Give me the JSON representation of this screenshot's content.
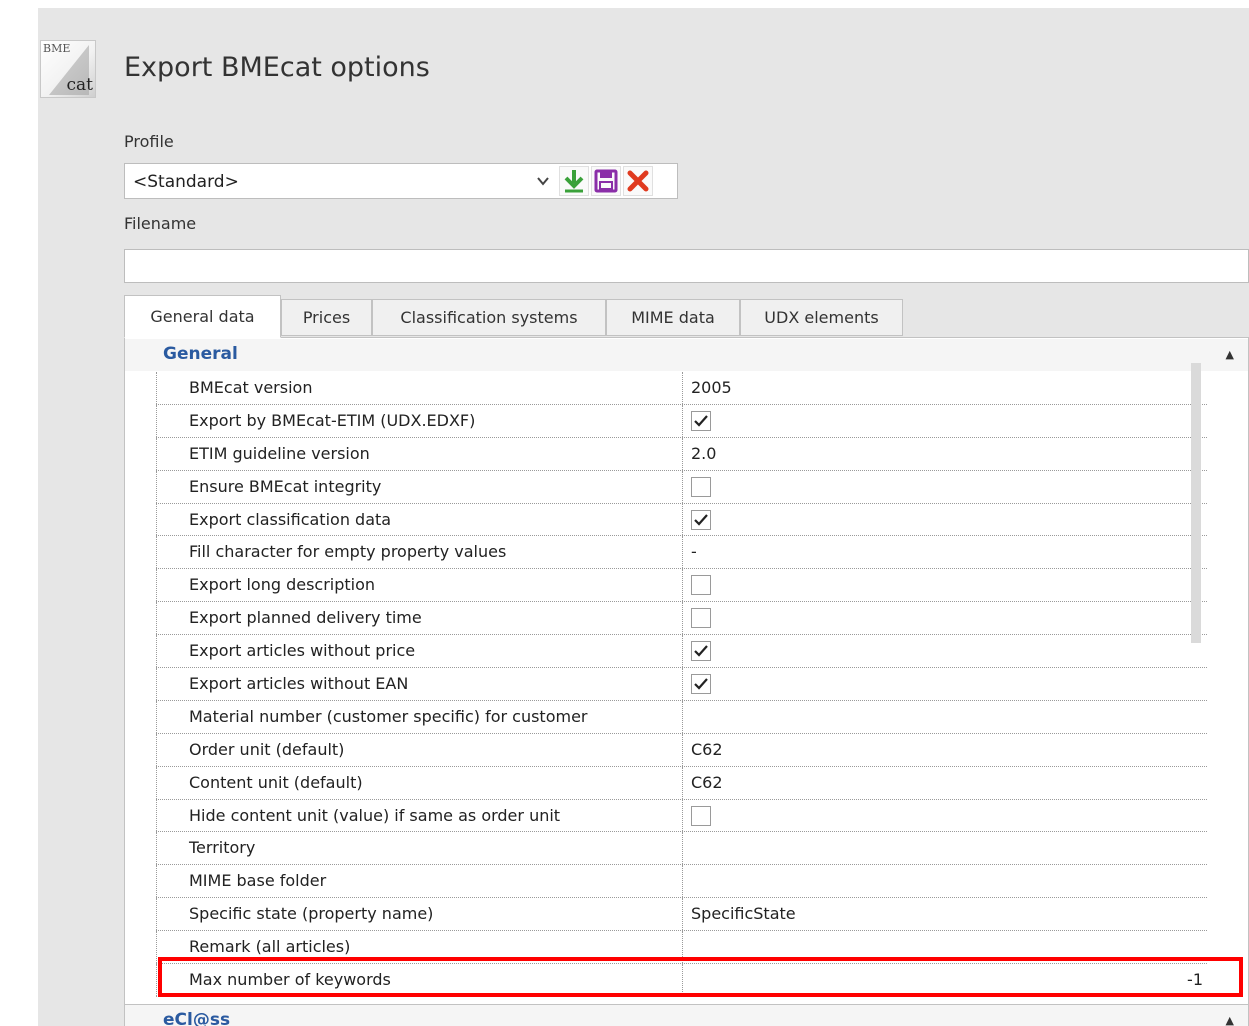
{
  "app": {
    "icon_line1": "BME",
    "icon_line2": "cat",
    "title": "Export BMEcat options"
  },
  "profile": {
    "label": "Profile",
    "value": "<Standard>"
  },
  "filename": {
    "label": "Filename",
    "value": ""
  },
  "tabs": [
    {
      "label": "General data",
      "active": true
    },
    {
      "label": "Prices",
      "active": false
    },
    {
      "label": "Classification systems",
      "active": false
    },
    {
      "label": "MIME data",
      "active": false
    },
    {
      "label": "UDX elements",
      "active": false
    }
  ],
  "categories": {
    "general": "General",
    "eclass": "eCl@ss"
  },
  "properties": [
    {
      "name": "BMEcat version",
      "type": "text",
      "value": "2005"
    },
    {
      "name": "Export by BMEcat-ETIM (UDX.EDXF)",
      "type": "checkbox",
      "checked": true
    },
    {
      "name": "ETIM guideline version",
      "type": "text",
      "value": "2.0"
    },
    {
      "name": "Ensure BMEcat integrity",
      "type": "checkbox",
      "checked": false
    },
    {
      "name": "Export classification data",
      "type": "checkbox",
      "checked": true
    },
    {
      "name": "Fill character for empty property values",
      "type": "text",
      "value": "-"
    },
    {
      "name": "Export long description",
      "type": "checkbox",
      "checked": false
    },
    {
      "name": "Export planned delivery time",
      "type": "checkbox",
      "checked": false
    },
    {
      "name": "Export articles without price",
      "type": "checkbox",
      "checked": true
    },
    {
      "name": "Export articles without EAN",
      "type": "checkbox",
      "checked": true
    },
    {
      "name": "Material number (customer specific) for customer",
      "type": "text",
      "value": ""
    },
    {
      "name": "Order unit (default)",
      "type": "text",
      "value": "C62"
    },
    {
      "name": "Content unit (default)",
      "type": "text",
      "value": "C62"
    },
    {
      "name": "Hide content unit (value) if same as order unit",
      "type": "checkbox",
      "checked": false
    },
    {
      "name": "Territory",
      "type": "text",
      "value": ""
    },
    {
      "name": "MIME base folder",
      "type": "text",
      "value": ""
    },
    {
      "name": "Specific state (property name)",
      "type": "text",
      "value": "SpecificState"
    },
    {
      "name": "Remark (all articles)",
      "type": "text",
      "value": ""
    },
    {
      "name": "Max number of keywords",
      "type": "text",
      "value": "-1",
      "align": "right"
    }
  ],
  "colors": {
    "category_text": "#2a5aa0",
    "highlight": "#ff0000",
    "load_icon": "#3aa13a",
    "save_icon": "#8a2ea8",
    "delete_icon": "#e03a1f"
  }
}
